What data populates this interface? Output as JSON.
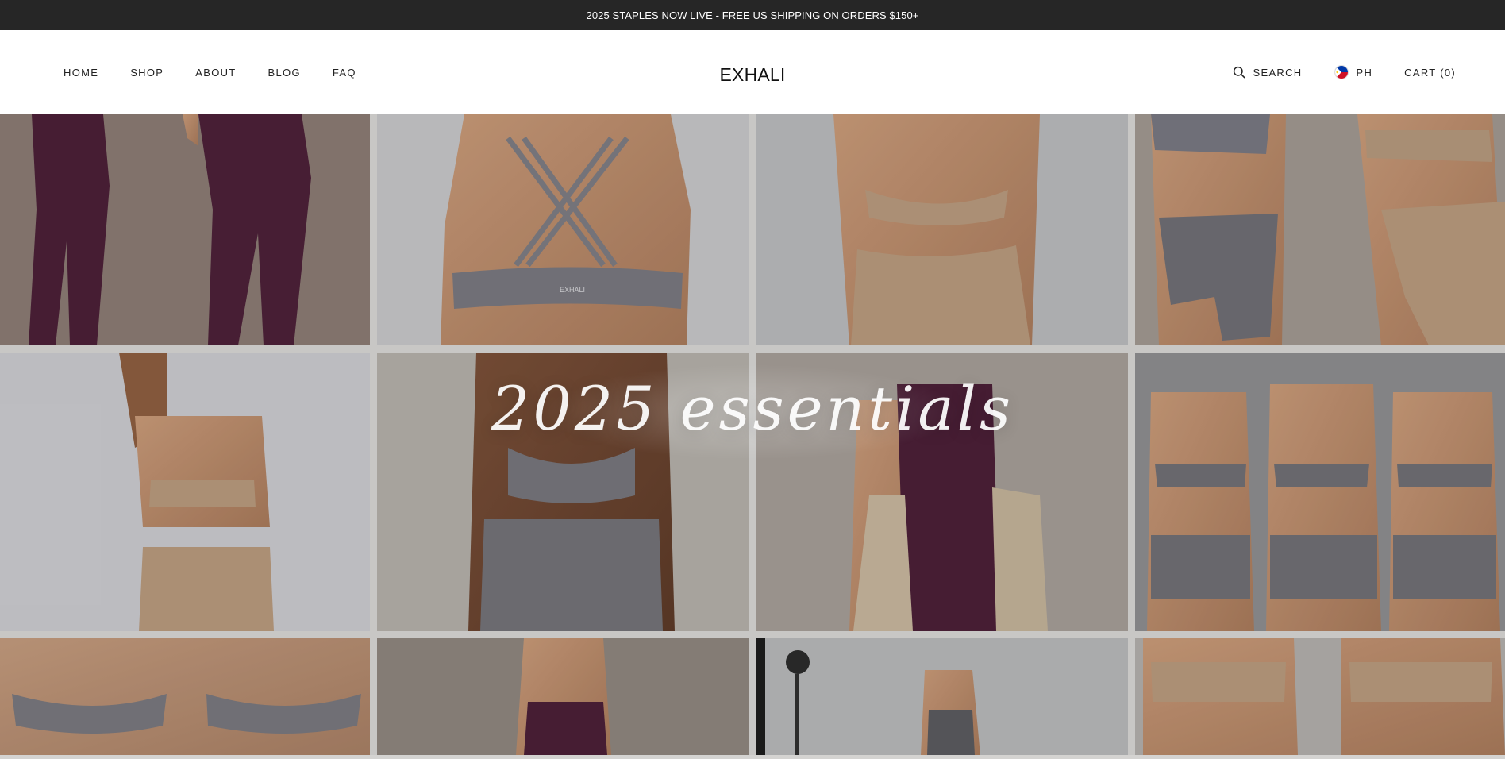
{
  "announcement": "2025 STAPLES NOW LIVE - FREE US SHIPPING ON ORDERS $150+",
  "nav": {
    "home": "HOME",
    "shop": "SHOP",
    "about": "ABOUT",
    "blog": "BLOG",
    "faq": "FAQ"
  },
  "logo": "EXHALI",
  "header_right": {
    "search_label": "SEARCH",
    "country": "PH",
    "cart_label": "CART (0)"
  },
  "hero": {
    "headline": "2025 essentials",
    "bra_print": "EXHALI"
  },
  "colors": {
    "announcement_bg": "#262626",
    "plum": "#4a1e36",
    "sand": "#b8997c",
    "slate": "#6f6e73"
  }
}
